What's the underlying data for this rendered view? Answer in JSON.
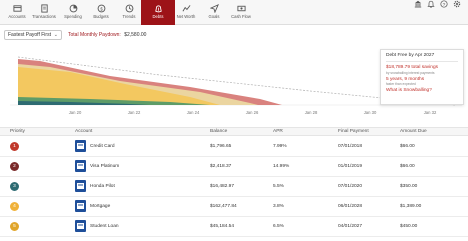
{
  "nav": {
    "items": [
      {
        "label": "Accounts",
        "icon": "accounts-icon"
      },
      {
        "label": "Transactions",
        "icon": "transactions-icon"
      },
      {
        "label": "Spending",
        "icon": "spending-icon"
      },
      {
        "label": "Budgets",
        "icon": "budgets-icon"
      },
      {
        "label": "Trends",
        "icon": "trends-icon"
      },
      {
        "label": "Debts",
        "icon": "debts-icon",
        "active": true
      },
      {
        "label": "Net Worth",
        "icon": "net-worth-icon"
      },
      {
        "label": "Goals",
        "icon": "goals-icon"
      },
      {
        "label": "Cash Flow",
        "icon": "cash-flow-icon"
      }
    ],
    "right_icons": [
      "bank-icon",
      "bell-icon",
      "help-icon",
      "settings-icon"
    ]
  },
  "toolbar": {
    "strategy_value": "Fastest Payoff First",
    "payoff_label": "Total Monthly Paydown:",
    "payoff_value": "$2,580.00"
  },
  "chart": {
    "x_ticks": [
      "Jan 20",
      "Jan 22",
      "Jan 24",
      "Jan 26",
      "Jan 28",
      "Jan 30",
      "Jan 32"
    ],
    "colors": {
      "accent": "#9d1318",
      "credit_card": "#d9827e",
      "visa": "#ebd5a0",
      "honda": "#2e6b72",
      "mortgage": "#f3c860",
      "student_loan": "#5e9c68",
      "plan_line": "#b0b0b0"
    }
  },
  "card": {
    "title": "Debt Free by Apr 2027",
    "savings": "$18,789.79 total savings",
    "savings_sub": "by snowballing interest payments",
    "time": "5 years, 9 months",
    "time_sub": "faster than expected",
    "question": "What is Snowballing?"
  },
  "table": {
    "headers": {
      "priority": "Priority",
      "account": "Account",
      "balance": "Balance",
      "apr": "APR",
      "final_payment": "Final Payment",
      "amount_due": "Amount Due"
    },
    "rows": [
      {
        "priority": "1",
        "color": "#c0392b",
        "account": "Credit Card",
        "balance": "$1,796.65",
        "apr": "7.99%",
        "final_payment": "07/01/2018",
        "amount_due": "$66.00"
      },
      {
        "priority": "2",
        "color": "#7a2a2a",
        "account": "Visa Platinum",
        "balance": "$2,418.37",
        "apr": "14.99%",
        "final_payment": "01/01/2019",
        "amount_due": "$66.00"
      },
      {
        "priority": "3",
        "color": "#2e6b72",
        "account": "Honda Pilot",
        "balance": "$16,482.97",
        "apr": "5.5%",
        "final_payment": "07/01/2020",
        "amount_due": "$350.00"
      },
      {
        "priority": "4",
        "color": "#f0b23a",
        "account": "Mortgage",
        "balance": "$162,477.84",
        "apr": "3.8%",
        "final_payment": "06/01/2028",
        "amount_due": "$1,389.00"
      },
      {
        "priority": "5",
        "color": "#e0a52a",
        "account": "Student Loan",
        "balance": "$45,184.54",
        "apr": "6.5%",
        "final_payment": "04/01/2027",
        "amount_due": "$450.00"
      }
    ]
  }
}
